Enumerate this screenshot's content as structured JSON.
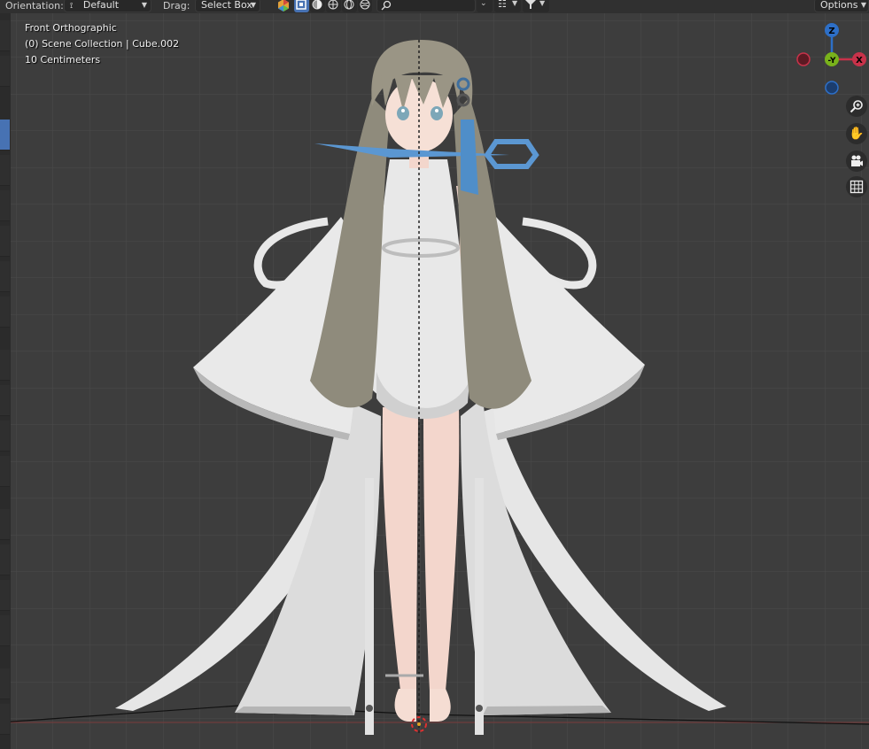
{
  "header": {
    "orientation_label": "Orientation:",
    "orientation_value": "Default",
    "drag_label": "Drag:",
    "drag_value": "Select Box",
    "options_label": "Options"
  },
  "viewport": {
    "view_name": "Front Orthographic",
    "collection_path": "(0) Scene Collection | Cube.002",
    "scale_text": "10 Centimeters"
  },
  "gizmo": {
    "z_label": "Z",
    "y_label": "-Y",
    "x_label": "X",
    "colors": {
      "x": "#c8324a",
      "y": "#79b21b",
      "z": "#2d6fc7",
      "x_neg": "#5c1a23",
      "y_neg": "#3a5a10",
      "z_neg": "#1b3d6e"
    }
  },
  "nav": {
    "zoom_icon": "zoom-icon",
    "pan_icon": "hand-icon",
    "camera_icon": "camera-icon",
    "grid_icon": "grid-icon"
  },
  "colors": {
    "accent": "#4772b3",
    "viewport_bg": "#3d3d3d",
    "header_bg": "#303030"
  }
}
